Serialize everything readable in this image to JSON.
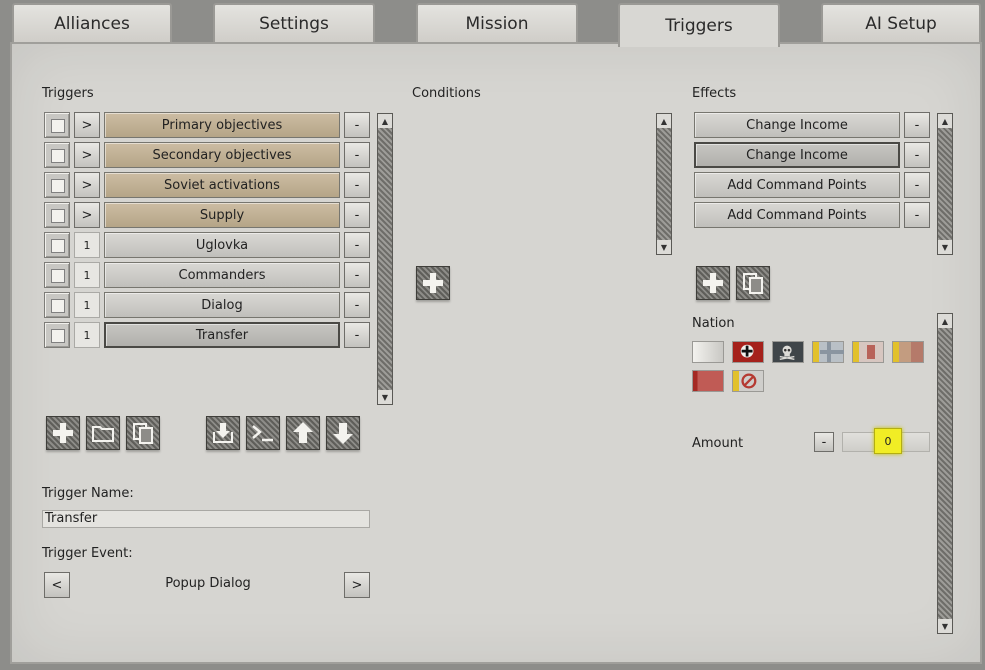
{
  "tabs": [
    {
      "label": "Alliances"
    },
    {
      "label": "Settings"
    },
    {
      "label": "Mission"
    },
    {
      "label": "Triggers"
    },
    {
      "label": "AI Setup"
    }
  ],
  "triggers": {
    "heading": "Triggers",
    "remove_label": "-",
    "items": [
      {
        "toggle": ">",
        "label": "Primary objectives",
        "style": "group"
      },
      {
        "toggle": ">",
        "label": "Secondary objectives",
        "style": "group"
      },
      {
        "toggle": ">",
        "label": "Soviet activations",
        "style": "group"
      },
      {
        "toggle": ">",
        "label": "Supply",
        "style": "group"
      },
      {
        "count": "1",
        "label": "Uglovka",
        "style": "trigger"
      },
      {
        "count": "1",
        "label": "Commanders",
        "style": "trigger"
      },
      {
        "count": "1",
        "label": "Dialog",
        "style": "trigger"
      },
      {
        "count": "1",
        "label": "Transfer",
        "style": "selected"
      }
    ],
    "toolbar_icons": [
      "add-icon",
      "folder-icon",
      "copy-icon",
      "import-icon",
      "console-icon",
      "move-up-icon",
      "move-down-icon"
    ]
  },
  "trigger_name": {
    "label": "Trigger Name:",
    "value": "Transfer"
  },
  "trigger_event": {
    "label": "Trigger Event:",
    "prev": "<",
    "value": "Popup Dialog",
    "next": ">"
  },
  "conditions": {
    "heading": "Conditions"
  },
  "effects": {
    "heading": "Effects",
    "remove_label": "-",
    "items": [
      {
        "label": "Change Income"
      },
      {
        "label": "Change Income"
      },
      {
        "label": "Add Command Points"
      },
      {
        "label": "Add Command Points"
      }
    ]
  },
  "nation": {
    "heading": "Nation",
    "flags": [
      "blank-flag",
      "germany-flag",
      "skull-flag",
      "yellow-grey-flag",
      "yellow-red-flag",
      "yellow-tan-flag",
      "red-flag",
      "none-flag"
    ]
  },
  "amount": {
    "label": "Amount",
    "minus": "-",
    "value": "0"
  },
  "colors": {
    "panel": "#d6d5d1",
    "group_bar": "#c4b498",
    "highlight": "#f1ed25"
  }
}
